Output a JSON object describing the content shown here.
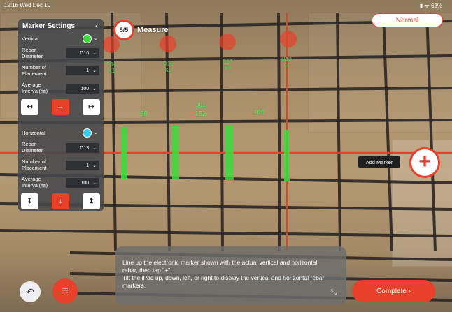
{
  "status_bar": {
    "time": "12:16 Wed Dec 10",
    "right": "▮ ᯤ 63%"
  },
  "mode_button": {
    "label": "Normal"
  },
  "measure": {
    "count": "5/5",
    "title": "Measure"
  },
  "settings": {
    "title": "Marker Settings",
    "vertical": {
      "label": "Vertical",
      "color": "#3ddc3d",
      "rebar_diameter_label": "Rebar\nDiameter",
      "rebar_diameter": "D10",
      "placement_label": "Number of\nPlacement",
      "placement": "1",
      "interval_label": "Average\nInterval(㎜)",
      "interval": "100",
      "align_buttons": [
        "↤",
        "↔",
        "↦"
      ]
    },
    "horizontal": {
      "label": "Horizontal",
      "color": "#34d0f0",
      "rebar_diameter_label": "Rebar\nDiameter",
      "rebar_diameter": "D13",
      "placement_label": "Number of\nPlacement",
      "placement": "1",
      "interval_label": "Average\nInterval(㎜)",
      "interval": "100",
      "align_buttons": [
        "↧",
        "↕",
        "↥"
      ]
    }
  },
  "spacing_labels": [
    "98",
    "152",
    "100"
  ],
  "spacing_sublabel": "301",
  "rebar_tags": [
    {
      "top": "D10",
      "bottom": "X1"
    },
    {
      "top": "D10",
      "bottom": "X2"
    },
    {
      "top": "D10",
      "bottom": "X3"
    },
    {
      "top": "D10",
      "bottom": "X4"
    }
  ],
  "add_marker": {
    "tooltip": "Add Marker",
    "icon": "plus-icon"
  },
  "instruction": {
    "line1": "Line up the electronic marker shown with the actual vertical and horizontal rebar, then tap \"+\".",
    "line2": "Tilt the iPad up, down, left, or right to display the vertical and horizontal rebar markers."
  },
  "undo_button": {
    "icon": "undo-icon"
  },
  "menu_button": {
    "icon": "menu-icon"
  },
  "complete_button": {
    "label": "Complete ›"
  },
  "colors": {
    "accent": "#e8402a",
    "marker_green": "#3ddc3d",
    "marker_red": "#e8402a"
  }
}
